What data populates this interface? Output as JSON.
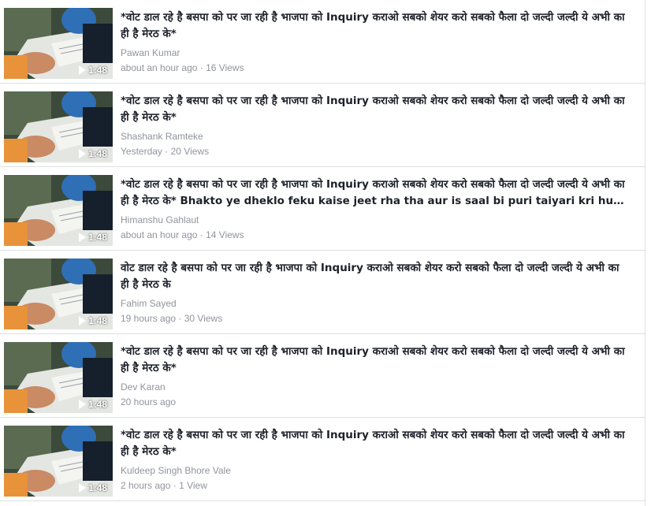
{
  "videos": [
    {
      "title": "*वोट डाल रहे है बसपा को पर जा रही है भाजपा को Inquiry कराओ सबको शेयर करो सबको फैला दो जल्दी जल्दी ये अभी का ही है मेरठ के*",
      "author": "Pawan Kumar",
      "time": "about an hour ago",
      "views": "16 Views",
      "duration": "1:48"
    },
    {
      "title": "*वोट डाल रहे है बसपा को पर जा रही है भाजपा को Inquiry कराओ सबको शेयर करो सबको फैला दो जल्दी जल्दी ये अभी का ही है मेरठ के*",
      "author": "Shashank Ramteke",
      "time": "Yesterday",
      "views": "20 Views",
      "duration": "1:48"
    },
    {
      "title": "*वोट डाल रहे है बसपा को पर जा रही है भाजपा को Inquiry कराओ सबको शेयर करो सबको फैला दो जल्दी जल्दी ये अभी का ही है मेरठ के* Bhakto ye dheklo feku kaise jeet rha tha aur is saal bi puri taiyari kri hue hai EV...",
      "author": "Himanshu Gahlaut",
      "time": "about an hour ago",
      "views": "14 Views",
      "duration": "1:48"
    },
    {
      "title": "वोट डाल रहे है बसपा को पर जा रही है भाजपा को Inquiry कराओ सबको शेयर करो सबको फैला दो जल्दी जल्दी ये अभी का ही है मेरठ के",
      "author": "Fahim Sayed",
      "time": "19 hours ago",
      "views": "30 Views",
      "duration": "1:48"
    },
    {
      "title": "*वोट डाल रहे है बसपा को पर जा रही है भाजपा को Inquiry कराओ सबको शेयर करो सबको फैला दो जल्दी जल्दी ये अभी का ही है मेरठ के*",
      "author": "Dev Karan",
      "time": "20 hours ago",
      "views": "",
      "duration": "1:48"
    },
    {
      "title": "*वोट डाल रहे है बसपा को पर जा रही है भाजपा को Inquiry कराओ सबको शेयर करो सबको फैला दो जल्दी जल्दी ये अभी का ही है मेरठ के*",
      "author": "Kuldeep Singh Bhore Vale",
      "time": "2 hours ago",
      "views": "1 View",
      "duration": "1:48"
    }
  ],
  "icons": {
    "play": "play-icon"
  },
  "colors": {
    "title": "#1d2129",
    "meta": "#90949c",
    "divider": "#dddfe2"
  }
}
